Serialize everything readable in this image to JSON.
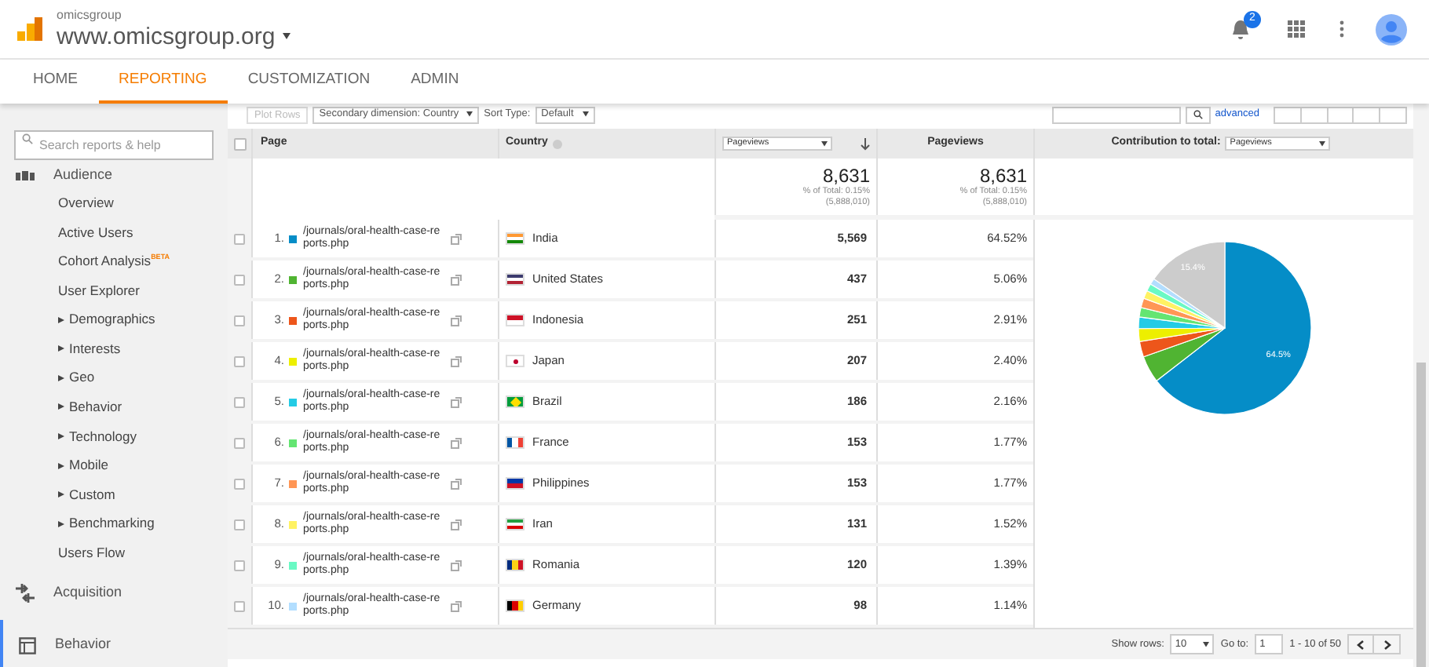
{
  "header": {
    "account": "omicsgroup",
    "property": "www.omicsgroup.org",
    "notifications": "2"
  },
  "nav_tabs": [
    {
      "label": "HOME",
      "selected": false
    },
    {
      "label": "REPORTING",
      "selected": true
    },
    {
      "label": "CUSTOMIZATION",
      "selected": false
    },
    {
      "label": "ADMIN",
      "selected": false
    }
  ],
  "sidebar": {
    "search": {
      "placeholder": "Search reports & help"
    },
    "sections": [
      {
        "label": "Audience",
        "selected": false,
        "children": [
          {
            "label": "Overview",
            "kind": "link"
          },
          {
            "label": "Active Users",
            "kind": "link"
          },
          {
            "label": "Cohort Analysis",
            "badge": "BETA",
            "kind": "link"
          },
          {
            "label": "User Explorer",
            "kind": "link"
          },
          {
            "label": "Demographics",
            "kind": "group"
          },
          {
            "label": "Interests",
            "kind": "group"
          },
          {
            "label": "Geo",
            "kind": "group"
          },
          {
            "label": "Behavior",
            "kind": "group"
          },
          {
            "label": "Technology",
            "kind": "group"
          },
          {
            "label": "Mobile",
            "kind": "group"
          },
          {
            "label": "Custom",
            "kind": "group"
          },
          {
            "label": "Benchmarking",
            "kind": "group"
          },
          {
            "label": "Users Flow",
            "kind": "link"
          }
        ]
      },
      {
        "label": "Acquisition",
        "selected": false
      },
      {
        "label": "Behavior",
        "selected": true
      }
    ]
  },
  "toolbar": {
    "plot_rows": "Plot Rows",
    "secondary_dimension": "Secondary dimension: Country",
    "sort_type_label": "Sort Type:",
    "sort_type": "Default",
    "advanced": "advanced"
  },
  "table": {
    "all_checked": false,
    "columns": [
      "Page",
      "Country",
      "Pageviews",
      "Pageviews",
      "Contribution to total:"
    ],
    "contribution_metric": "Pageviews",
    "totals": [
      {
        "value": "8,631",
        "share": "% of Total: 0.15%",
        "total": "(5,888,010)"
      },
      {
        "value": "8,631",
        "share": "% of Total: 0.15%",
        "total": "(5,888,010)"
      }
    ],
    "rows": [
      {
        "index": "1.",
        "page": "/journals/oral-health-case-reports.php",
        "country": "India",
        "pageviews": "5,569",
        "percent": "64.52%",
        "color": "#058dc7",
        "checked": false
      },
      {
        "index": "2.",
        "page": "/journals/oral-health-case-reports.php",
        "country": "United States",
        "pageviews": "437",
        "percent": "5.06%",
        "color": "#50b432",
        "checked": false
      },
      {
        "index": "3.",
        "page": "/journals/oral-health-case-reports.php",
        "country": "Indonesia",
        "pageviews": "251",
        "percent": "2.91%",
        "color": "#ed561b",
        "checked": false
      },
      {
        "index": "4.",
        "page": "/journals/oral-health-case-reports.php",
        "country": "Japan",
        "pageviews": "207",
        "percent": "2.40%",
        "color": "#edef00",
        "checked": false
      },
      {
        "index": "5.",
        "page": "/journals/oral-health-case-reports.php",
        "country": "Brazil",
        "pageviews": "186",
        "percent": "2.16%",
        "color": "#24cbe5",
        "checked": false
      },
      {
        "index": "6.",
        "page": "/journals/oral-health-case-reports.php",
        "country": "France",
        "pageviews": "153",
        "percent": "1.77%",
        "color": "#64e572",
        "checked": false
      },
      {
        "index": "7.",
        "page": "/journals/oral-health-case-reports.php",
        "country": "Philippines",
        "pageviews": "153",
        "percent": "1.77%",
        "color": "#ff9655",
        "checked": false
      },
      {
        "index": "8.",
        "page": "/journals/oral-health-case-reports.php",
        "country": "Iran",
        "pageviews": "131",
        "percent": "1.52%",
        "color": "#fff263",
        "checked": false
      },
      {
        "index": "9.",
        "page": "/journals/oral-health-case-reports.php",
        "country": "Romania",
        "pageviews": "120",
        "percent": "1.39%",
        "color": "#6af9c4",
        "checked": false
      },
      {
        "index": "10.",
        "page": "/journals/oral-health-case-reports.php",
        "country": "Germany",
        "pageviews": "98",
        "percent": "1.14%",
        "color": "#b2deff",
        "checked": false
      }
    ],
    "chart_data": {
      "type": "pie",
      "values": [
        64.52,
        5.06,
        2.91,
        2.4,
        2.16,
        1.77,
        1.77,
        1.52,
        1.39,
        1.14,
        15.36
      ],
      "annotations": [
        {
          "text": "64.5%"
        },
        {
          "text": "15.4%"
        }
      ]
    }
  },
  "pagination": {
    "show_rows_label": "Show rows:",
    "show_rows": "10",
    "goto_label": "Go to:",
    "goto": "1",
    "range": "1 - 10 of 50"
  }
}
